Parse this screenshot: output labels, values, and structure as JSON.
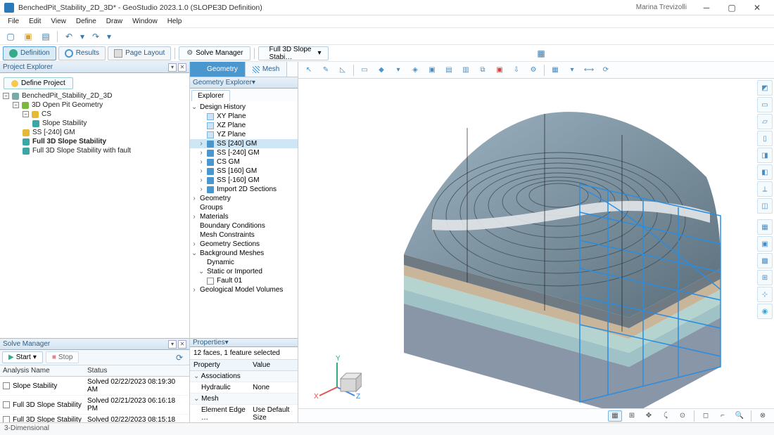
{
  "title": "BenchedPit_Stability_2D_3D* - GeoStudio 2023.1.0 (SLOPE3D Definition)",
  "user": "Marina Trevizolli",
  "menu": [
    "File",
    "Edit",
    "View",
    "Define",
    "Draw",
    "Window",
    "Help"
  ],
  "ribbon": {
    "definition": "Definition",
    "results": "Results",
    "pagelayout": "Page Layout",
    "solvemgr": "Solve Manager",
    "full3d": "Full 3D Slope Stabi…"
  },
  "projectExplorer": {
    "title": "Project Explorer",
    "defineProject": "Define Project",
    "tree": {
      "root": "BenchedPit_Stability_2D_3D",
      "geom": "3D Open Pit Geometry",
      "cs": "CS",
      "slope": "Slope Stability",
      "ss240": "SS [-240] GM",
      "full3d": "Full 3D Slope Stability",
      "full3df": "Full 3D Slope Stability with fault"
    }
  },
  "solveManager": {
    "title": "Solve Manager",
    "start": "Start",
    "stop": "Stop",
    "cols": {
      "name": "Analysis Name",
      "status": "Status"
    },
    "rows": [
      {
        "name": "Slope Stability",
        "status": "Solved 02/22/2023 08:19:30 AM"
      },
      {
        "name": "Full 3D Slope Stability",
        "status": "Solved 02/21/2023 06:16:18 PM"
      },
      {
        "name": "Full 3D Slope Stability with fault",
        "status": "Solved 02/22/2023 08:15:18 AM"
      }
    ]
  },
  "geomTabs": {
    "geometry": "Geometry",
    "mesh": "Mesh"
  },
  "geomExplorer": {
    "title": "Geometry Explorer",
    "tab": "Explorer",
    "designHistory": "Design History",
    "xy": "XY Plane",
    "xz": "XZ Plane",
    "yz": "YZ Plane",
    "ss240p": "SS [240] GM",
    "ssn240": "SS [-240] GM",
    "csgm": "CS GM",
    "ss160": "SS [160] GM",
    "ssn160": "SS [-160] GM",
    "import2d": "Import 2D Sections",
    "geometry": "Geometry",
    "groups": "Groups",
    "materials": "Materials",
    "bc": "Boundary Conditions",
    "meshc": "Mesh Constraints",
    "gsec": "Geometry Sections",
    "bgmesh": "Background Meshes",
    "dynamic": "Dynamic",
    "staticimp": "Static or Imported",
    "fault": "Fault 01",
    "gmv": "Geological Model Volumes"
  },
  "properties": {
    "title": "Properties",
    "selection": "12 faces, 1 feature selected",
    "cols": {
      "prop": "Property",
      "val": "Value"
    },
    "assoc": "Associations",
    "hydraulic": "Hydraulic",
    "none": "None",
    "mesh": "Mesh",
    "edge": "Element Edge …",
    "usedef": "Use Default Size"
  },
  "status": "3-Dimensional"
}
